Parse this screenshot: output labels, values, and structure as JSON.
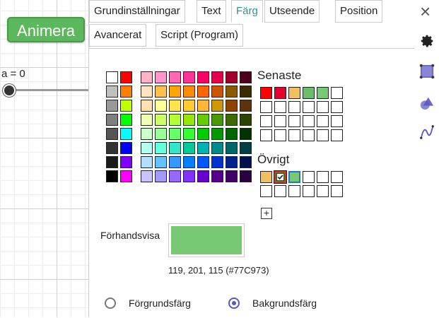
{
  "graphics": {
    "animate_button": "Animera",
    "slider_label": "a = 0"
  },
  "tabs": {
    "basic": "Grundinställningar",
    "text": "Text",
    "color": "Färg",
    "style": "Utseende",
    "position": "Position",
    "advanced": "Avancerat",
    "scripting": "Script (Program)"
  },
  "color_panel": {
    "recent_heading": "Senaste",
    "other_heading": "Övrigt",
    "preview_label": "Förhandsvisa",
    "preview_color": "#77C973",
    "rgb_text": "119, 201, 115 (#77C973)",
    "foreground_label": "Förgrundsfärg",
    "background_label": "Bakgrundsfärg",
    "selected_mode": "background",
    "add_symbol": "+",
    "basic_colors": [
      [
        "#FFFFFF",
        "#FF0000"
      ],
      [
        "#C0C0C0",
        "#FF7F00"
      ],
      [
        "#999999",
        "#BFFF00"
      ],
      [
        "#7F7F7F",
        "#00FF00"
      ],
      [
        "#555555",
        "#00FFFF"
      ],
      [
        "#333333",
        "#0000FF"
      ],
      [
        "#1A1A1A",
        "#7F00FF"
      ],
      [
        "#000000",
        "#FF00FF"
      ]
    ],
    "palette": [
      [
        "#FFB3C6",
        "#FF99CC",
        "#FF69B4",
        "#FF3399",
        "#FF0066",
        "#E6004C",
        "#A0002B",
        "#4D0019"
      ],
      [
        "#FFE4C4",
        "#FFC04D",
        "#FFA500",
        "#FF8C00",
        "#FF6600",
        "#CC5500",
        "#8B5A00",
        "#3D2B00"
      ],
      [
        "#FFE0B3",
        "#FFFF99",
        "#FFE44D",
        "#FFCC33",
        "#FFB833",
        "#CC9900",
        "#8B4500",
        "#5C3310"
      ],
      [
        "#EEFFB3",
        "#CCFF66",
        "#B3FF33",
        "#99E600",
        "#66CC00",
        "#4D9900",
        "#3D6B00",
        "#2B4500"
      ],
      [
        "#CCFFCC",
        "#99FF99",
        "#66FF66",
        "#33FF33",
        "#00CC00",
        "#009900",
        "#006600",
        "#003300"
      ],
      [
        "#B3FFF0",
        "#66FFE0",
        "#33E6C9",
        "#00CC99",
        "#00B3B3",
        "#008B8B",
        "#006666",
        "#004040"
      ],
      [
        "#B3DFFF",
        "#66C2FF",
        "#3399FF",
        "#0080FF",
        "#0059FF",
        "#0033CC",
        "#00208B",
        "#001050"
      ],
      [
        "#C9C4FF",
        "#A599FF",
        "#9966FF",
        "#8033FF",
        "#6600CC",
        "#550088",
        "#400066",
        "#2B0040"
      ]
    ],
    "recent_colors": [
      "#FF0000",
      "#E6002E",
      "#F2C060",
      "#6CBF6A",
      "#77C973",
      "#FFFFFF"
    ],
    "other_colors": [
      "#F2C060",
      "#6B8E3A",
      "#77C973",
      "#FFFFFF",
      "#FFFFFF",
      "#FFFFFF"
    ]
  },
  "sidebar": {
    "close_symbol": "×"
  }
}
